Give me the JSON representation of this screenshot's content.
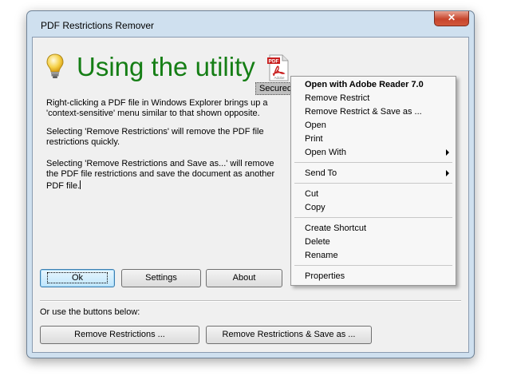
{
  "window": {
    "title": "PDF Restrictions Remover",
    "close_glyph": "✕"
  },
  "content": {
    "heading": "Using the utility",
    "paragraphs": [
      "Right-clicking a PDF file in Windows Explorer brings up a 'context-sensitive' menu similar to that shown opposite.",
      "Selecting 'Remove Restrictions' will remove the PDF file restrictions quickly.",
      "Selecting 'Remove Restrictions and Save as...' will remove the PDF file restrictions and save the document as another PDF file."
    ],
    "file_icon": {
      "badge": "PDF",
      "brand": "Adobe",
      "label": "Secured"
    }
  },
  "buttons": {
    "ok": "Ok",
    "settings": "Settings",
    "about": "About"
  },
  "footer": {
    "label": "Or use the buttons below:",
    "remove": "Remove Restrictions ...",
    "remove_save": "Remove Restrictions & Save as ..."
  },
  "context_menu": {
    "items": [
      "Open with Adobe Reader 7.0",
      "Remove Restrict",
      "Remove Restrict & Save as ...",
      "Open",
      "Print",
      "Open With",
      "Send To",
      "Cut",
      "Copy",
      "Create Shortcut",
      "Delete",
      "Rename",
      "Properties"
    ]
  }
}
